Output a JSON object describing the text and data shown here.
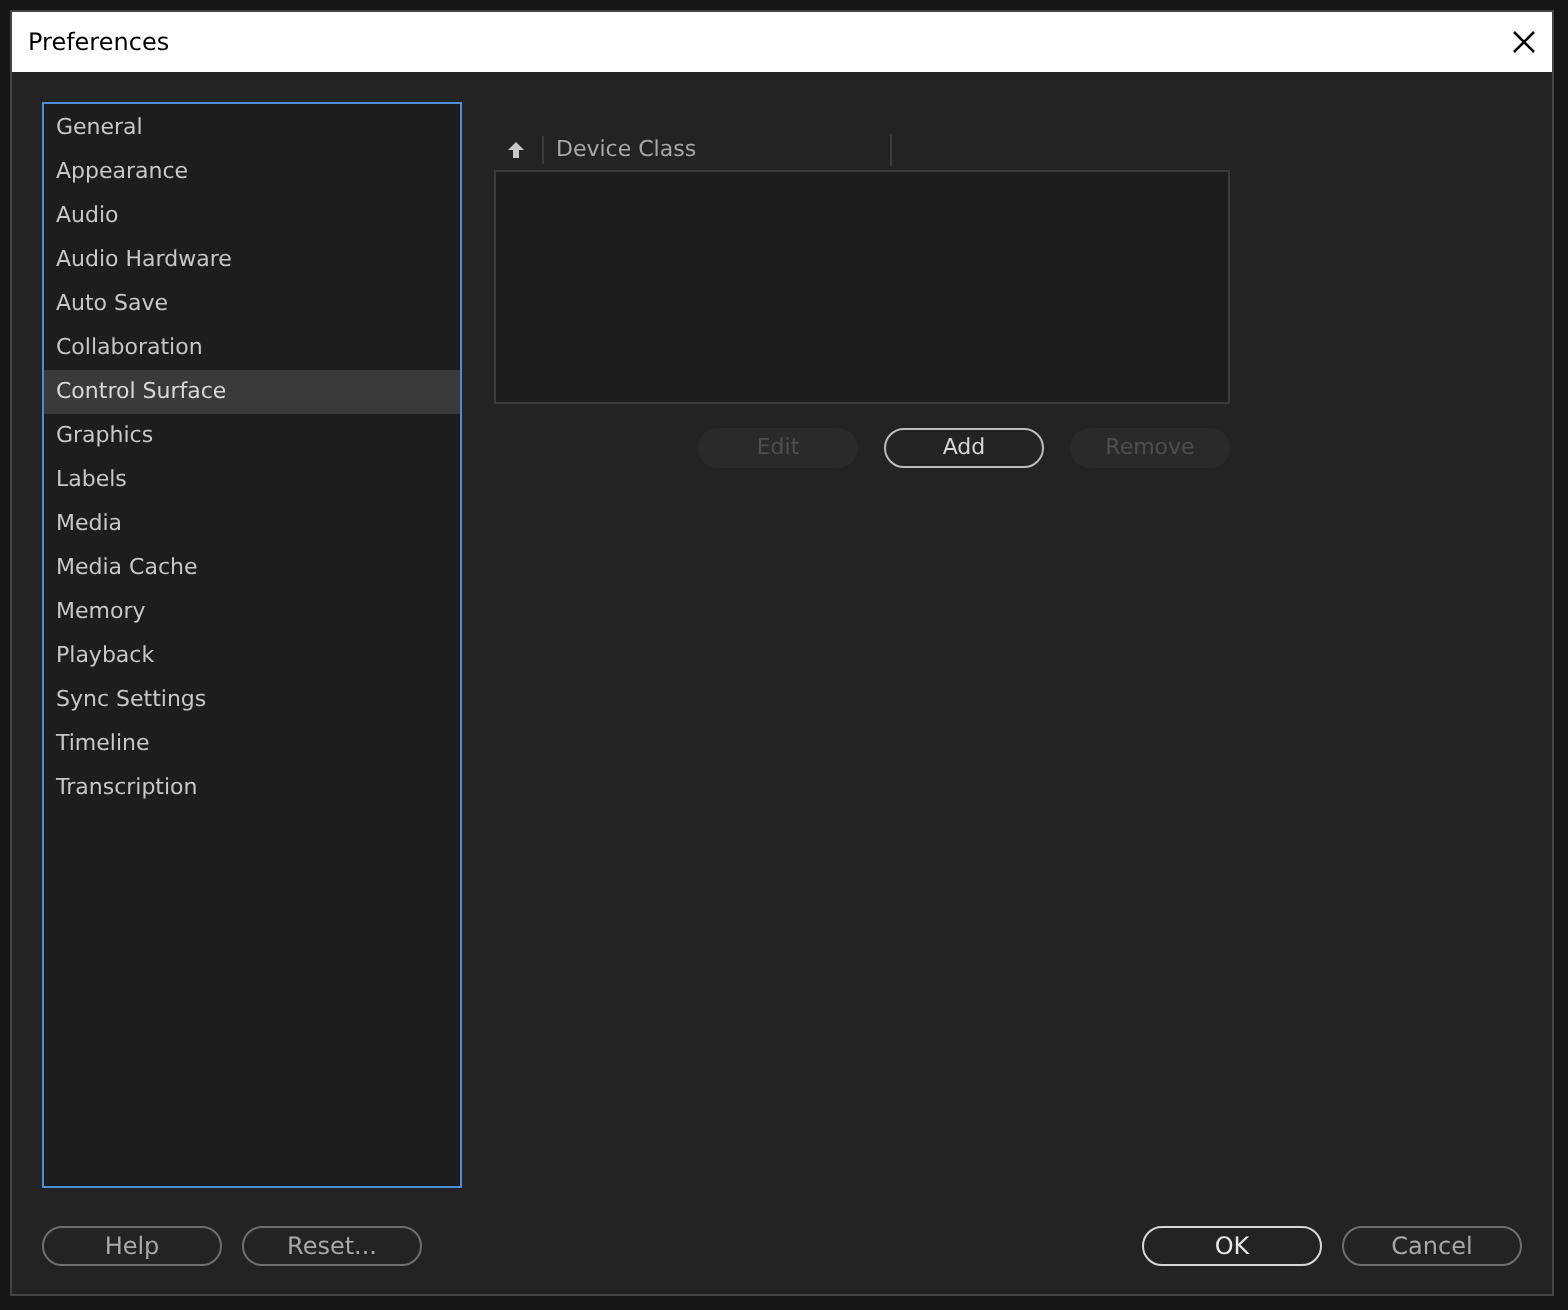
{
  "window": {
    "title": "Preferences"
  },
  "sidebar": {
    "items": [
      {
        "label": "General",
        "selected": false
      },
      {
        "label": "Appearance",
        "selected": false
      },
      {
        "label": "Audio",
        "selected": false
      },
      {
        "label": "Audio Hardware",
        "selected": false
      },
      {
        "label": "Auto Save",
        "selected": false
      },
      {
        "label": "Collaboration",
        "selected": false
      },
      {
        "label": "Control Surface",
        "selected": true
      },
      {
        "label": "Graphics",
        "selected": false
      },
      {
        "label": "Labels",
        "selected": false
      },
      {
        "label": "Media",
        "selected": false
      },
      {
        "label": "Media Cache",
        "selected": false
      },
      {
        "label": "Memory",
        "selected": false
      },
      {
        "label": "Playback",
        "selected": false
      },
      {
        "label": "Sync Settings",
        "selected": false
      },
      {
        "label": "Timeline",
        "selected": false
      },
      {
        "label": "Transcription",
        "selected": false
      }
    ]
  },
  "table": {
    "columns": [
      "Device Class"
    ]
  },
  "device_buttons": [
    {
      "label": "Edit",
      "disabled": true
    },
    {
      "label": "Add",
      "disabled": false
    },
    {
      "label": "Remove",
      "disabled": true
    }
  ],
  "footer_left": [
    {
      "label": "Help",
      "default": false
    },
    {
      "label": "Reset...",
      "default": false
    }
  ],
  "footer_right": [
    {
      "label": "OK",
      "default": true
    },
    {
      "label": "Cancel",
      "default": false
    }
  ]
}
